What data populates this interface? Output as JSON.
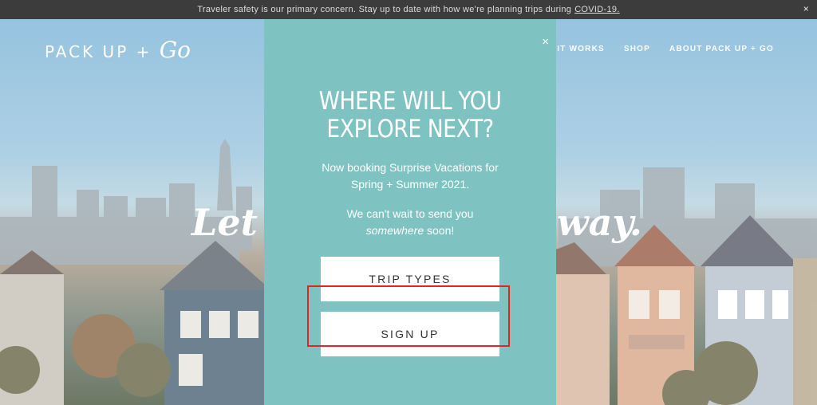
{
  "banner": {
    "text": "Traveler safety is our primary concern. Stay up to date with how we're planning trips during",
    "link": "COVID-19.",
    "close_glyph": "×"
  },
  "logo": {
    "text": "PACK UP +",
    "script": "Go"
  },
  "nav": {
    "items": [
      "HOW IT WORKS",
      "SHOP",
      "ABOUT PACK UP + GO"
    ]
  },
  "hero": {
    "headline_left": "Let",
    "headline_right": "way."
  },
  "modal": {
    "close_glyph": "×",
    "title_line1": "WHERE WILL YOU",
    "title_line2": "EXPLORE NEXT?",
    "subtitle_line1": "Now booking Surprise Vacations for",
    "subtitle_line2": "Spring + Summer 2021.",
    "note_line1": "We can't wait to send you",
    "note_emph": "somewhere",
    "note_tail": " soon!",
    "buttons": {
      "trip_types": "TRIP TYPES",
      "sign_up": "SIGN UP"
    },
    "accent_color": "#7ec3c1",
    "highlight_color": "#e0261f"
  }
}
